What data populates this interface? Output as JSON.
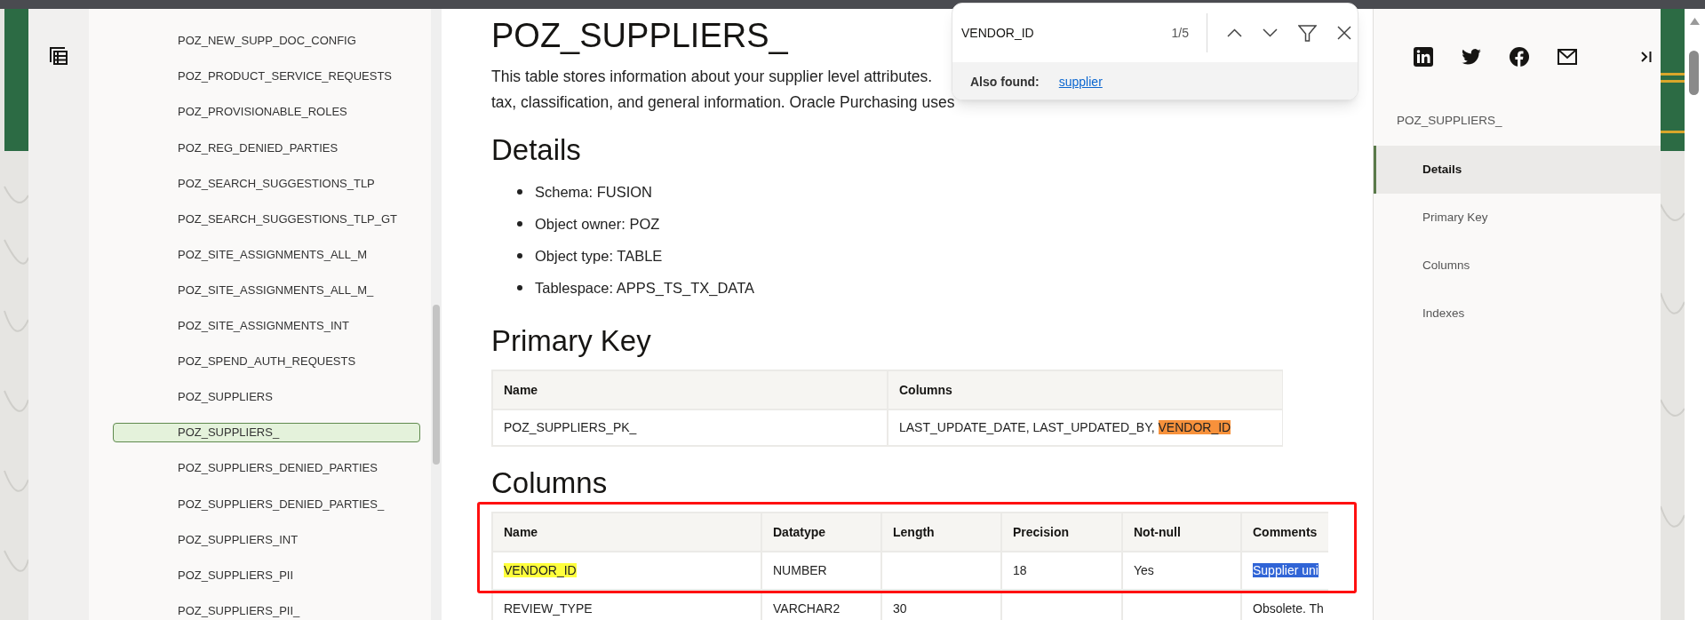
{
  "sidebar": {
    "items": [
      {
        "label": "POZ_NEW_SUPP_DOC_CONFIG",
        "selected": false
      },
      {
        "label": "POZ_PRODUCT_SERVICE_REQUESTS",
        "selected": false
      },
      {
        "label": "POZ_PROVISIONABLE_ROLES",
        "selected": false
      },
      {
        "label": "POZ_REG_DENIED_PARTIES",
        "selected": false
      },
      {
        "label": "POZ_SEARCH_SUGGESTIONS_TLP",
        "selected": false
      },
      {
        "label": "POZ_SEARCH_SUGGESTIONS_TLP_GT",
        "selected": false
      },
      {
        "label": "POZ_SITE_ASSIGNMENTS_ALL_M",
        "selected": false
      },
      {
        "label": "POZ_SITE_ASSIGNMENTS_ALL_M_",
        "selected": false
      },
      {
        "label": "POZ_SITE_ASSIGNMENTS_INT",
        "selected": false
      },
      {
        "label": "POZ_SPEND_AUTH_REQUESTS",
        "selected": false
      },
      {
        "label": "POZ_SUPPLIERS",
        "selected": false
      },
      {
        "label": "POZ_SUPPLIERS_",
        "selected": true
      },
      {
        "label": "POZ_SUPPLIERS_DENIED_PARTIES",
        "selected": false
      },
      {
        "label": "POZ_SUPPLIERS_DENIED_PARTIES_",
        "selected": false
      },
      {
        "label": "POZ_SUPPLIERS_INT",
        "selected": false
      },
      {
        "label": "POZ_SUPPLIERS_PII",
        "selected": false
      },
      {
        "label": "POZ_SUPPLIERS_PII_",
        "selected": false
      }
    ]
  },
  "page": {
    "title": "POZ_SUPPLIERS_",
    "description": [
      "This table stores information about your supplier level attributes.",
      "tax, classification, and general information. Oracle Purchasing uses"
    ],
    "details": {
      "heading": "Details",
      "items": [
        "Schema: FUSION",
        "Object owner: POZ",
        "Object type: TABLE",
        "Tablespace: APPS_TS_TX_DATA"
      ]
    },
    "primary_key": {
      "heading": "Primary Key",
      "columns": [
        "Name",
        "Columns"
      ],
      "rows": [
        [
          "POZ_SUPPLIERS_PK_",
          {
            "parts": [
              {
                "text": "LAST_UPDATE_DATE, LAST_UPDATED_BY, "
              },
              {
                "text": "VENDOR_ID",
                "match": true,
                "current": true
              }
            ]
          }
        ]
      ]
    },
    "columns": {
      "heading": "Columns",
      "outlined": true,
      "columns": [
        "Name",
        "Datatype",
        "Length",
        "Precision",
        "Not-null",
        "Comments"
      ],
      "rows": [
        [
          {
            "text": "VENDOR_ID",
            "match": true,
            "current": false
          },
          "NUMBER",
          null,
          "18",
          "Yes",
          {
            "text": "Supplier uni",
            "selected": true
          }
        ],
        [
          "REVIEW_TYPE",
          "VARCHAR2",
          "30",
          null,
          null,
          "Obsolete. Th"
        ]
      ]
    }
  },
  "find_bar": {
    "query": "VENDOR_ID",
    "count": "1/5",
    "also_found_label": "Also found:",
    "also_found_link": "supplier"
  },
  "toc": {
    "title": "POZ_SUPPLIERS_",
    "items": [
      {
        "label": "Details",
        "selected": true
      },
      {
        "label": "Primary Key",
        "selected": false
      },
      {
        "label": "Columns",
        "selected": false
      },
      {
        "label": "Indexes",
        "selected": false
      }
    ]
  }
}
